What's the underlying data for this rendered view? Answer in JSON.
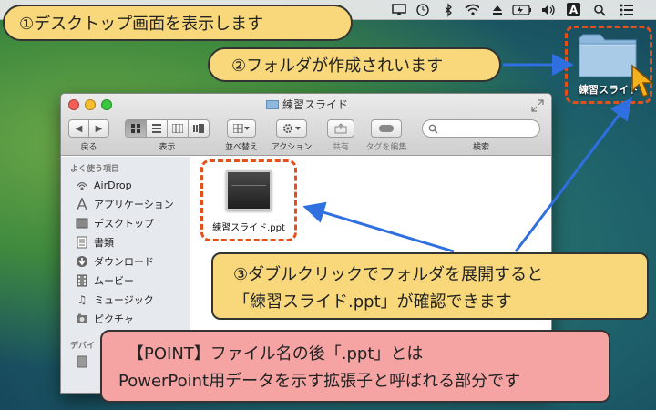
{
  "menubar": {
    "icons": [
      "airplay-icon",
      "time-machine-icon",
      "bluetooth-icon",
      "wifi-icon",
      "eject-icon",
      "battery-icon",
      "volume-icon",
      "input-source-icon",
      "spotlight-icon",
      "notification-center-icon"
    ],
    "input_source_glyph": "A"
  },
  "callouts": {
    "step1": "①デスクトップ画面を表示します",
    "step2": "②フォルダが作成されいます",
    "step3_line1": "③ダブルクリックでフォルダを展開すると",
    "step3_line2": "「練習スライド.ppt」が確認できます",
    "point_line1": "【POINT】ファイル名の後「.ppt」とは",
    "point_line2": "PowerPoint用データを示す拡張子と呼ばれる部分です"
  },
  "desktop": {
    "folder_label": "練習スライド"
  },
  "finder": {
    "title": "練習スライド",
    "toolbar": {
      "back_label": "戻る",
      "view_label": "表示",
      "arrange_label": "並べ替え",
      "action_label": "アクション",
      "share_label": "共有",
      "tags_label": "タグを編集",
      "search_label": "検索"
    },
    "sidebar": {
      "favorites_header": "よく使う項目",
      "items": [
        {
          "label": "AirDrop",
          "icon": "airdrop-icon"
        },
        {
          "label": "アプリケーション",
          "icon": "applications-icon"
        },
        {
          "label": "デスクトップ",
          "icon": "desktop-icon"
        },
        {
          "label": "書類",
          "icon": "documents-icon"
        },
        {
          "label": "ダウンロード",
          "icon": "downloads-icon"
        },
        {
          "label": "ムービー",
          "icon": "movies-icon"
        },
        {
          "label": "ミュージック",
          "icon": "music-icon"
        },
        {
          "label": "ピクチャ",
          "icon": "pictures-icon"
        }
      ],
      "devices_header": "デバイ"
    },
    "file": {
      "name": "練習スライド.ppt"
    }
  },
  "colors": {
    "callout_yellow": "#f8d87a",
    "callout_pink": "#f5a3a3",
    "highlight_dash": "#e4501c",
    "arrow_blue": "#2f6fe0"
  }
}
